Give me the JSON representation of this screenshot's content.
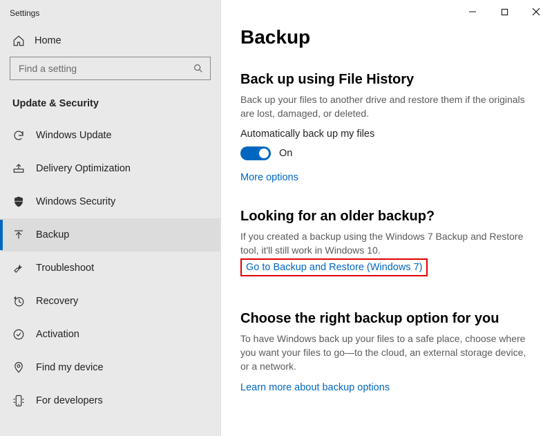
{
  "app_title": "Settings",
  "nav": {
    "home_label": "Home",
    "search_placeholder": "Find a setting",
    "section_title": "Update & Security",
    "items": [
      {
        "icon": "sync-icon",
        "label": "Windows Update"
      },
      {
        "icon": "delivery-icon",
        "label": "Delivery Optimization"
      },
      {
        "icon": "shield-icon",
        "label": "Windows Security"
      },
      {
        "icon": "backup-icon",
        "label": "Backup"
      },
      {
        "icon": "troubleshoot-icon",
        "label": "Troubleshoot"
      },
      {
        "icon": "recovery-icon",
        "label": "Recovery"
      },
      {
        "icon": "activation-icon",
        "label": "Activation"
      },
      {
        "icon": "find-device-icon",
        "label": "Find my device"
      },
      {
        "icon": "developers-icon",
        "label": "For developers"
      }
    ],
    "selected_index": 3
  },
  "page": {
    "title": "Backup",
    "section1": {
      "title": "Back up using File History",
      "desc": "Back up your files to another drive and restore them if the originals are lost, damaged, or deleted.",
      "toggle_label": "Automatically back up my files",
      "toggle_state": "On",
      "more_options": "More options"
    },
    "section2": {
      "title": "Looking for an older backup?",
      "desc": "If you created a backup using the Windows 7 Backup and Restore tool, it'll still work in Windows 10.",
      "link": "Go to Backup and Restore (Windows 7)"
    },
    "section3": {
      "title": "Choose the right backup option for you",
      "desc": "To have Windows back up your files to a safe place, choose where you want your files to go—to the cloud, an external storage device, or a network.",
      "link": "Learn more about backup options"
    }
  }
}
